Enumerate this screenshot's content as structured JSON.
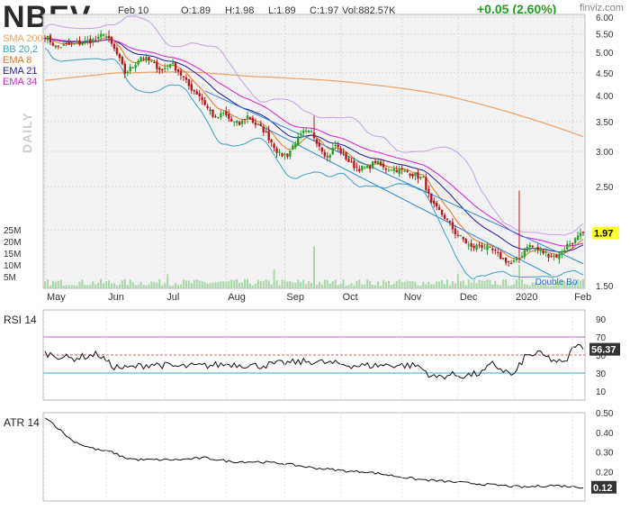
{
  "header": {
    "ticker": "NBEV",
    "date": "Feb 10",
    "open": "O:1.89",
    "high": "H:1.98",
    "low": "L:1.89",
    "close": "C:1.97",
    "volume": "Vol:882.57K",
    "change": "+0.05 (2.60%)",
    "logo": "finviz.com",
    "side_label": "DAILY"
  },
  "legend": [
    {
      "label": "SMA 200",
      "color": "#f0a060"
    },
    {
      "label": "BB 20,2",
      "color": "#3aa0c8"
    },
    {
      "label": "EMA 8",
      "color": "#e8761e"
    },
    {
      "label": "EMA 21",
      "color": "#1a1aa0"
    },
    {
      "label": "EMA 34",
      "color": "#d81ed8"
    }
  ],
  "colors": {
    "up": "#2aa02a",
    "down": "#b01e1e",
    "volume": "#a8d8a8",
    "price_tag_bg": "#ffff33",
    "channel": "#2a8ad8",
    "grid": "#d8d8d8"
  },
  "chart_data": [
    {
      "type": "line",
      "panel": "price",
      "scale": "log",
      "ylim": [
        1.5,
        6.0
      ],
      "y_ticks": [
        "6.00",
        "5.50",
        "5.00",
        "4.50",
        "4.00",
        "3.50",
        "3.00",
        "2.50",
        "2.00",
        "1.50"
      ],
      "y_tick_values": [
        6.0,
        5.5,
        5.0,
        4.5,
        4.0,
        3.5,
        3.0,
        2.5,
        2.0,
        1.5
      ],
      "months": [
        "May",
        "Jun",
        "Jul",
        "Aug",
        "Sep",
        "Oct",
        "Nov",
        "Dec",
        "2020",
        "Feb"
      ],
      "month_positions": [
        0,
        23,
        45,
        68,
        90,
        111,
        134,
        155,
        176,
        198
      ],
      "n_days": 203,
      "last_price": "1.97",
      "close_knots": [
        [
          0,
          5.45
        ],
        [
          4,
          5.15
        ],
        [
          10,
          5.2
        ],
        [
          16,
          5.3
        ],
        [
          20,
          5.35
        ],
        [
          22,
          5.55
        ],
        [
          25,
          5.2
        ],
        [
          27,
          4.95
        ],
        [
          30,
          4.5
        ],
        [
          33,
          4.65
        ],
        [
          36,
          4.9
        ],
        [
          40,
          4.75
        ],
        [
          44,
          4.55
        ],
        [
          47,
          4.75
        ],
        [
          50,
          4.55
        ],
        [
          54,
          4.2
        ],
        [
          58,
          4.0
        ],
        [
          61,
          3.75
        ],
        [
          64,
          3.55
        ],
        [
          67,
          3.65
        ],
        [
          70,
          3.5
        ],
        [
          73,
          3.45
        ],
        [
          76,
          3.6
        ],
        [
          79,
          3.45
        ],
        [
          82,
          3.35
        ],
        [
          85,
          3.15
        ],
        [
          88,
          2.95
        ],
        [
          91,
          2.95
        ],
        [
          94,
          3.15
        ],
        [
          97,
          3.3
        ],
        [
          100,
          3.3
        ],
        [
          103,
          3.1
        ],
        [
          106,
          2.9
        ],
        [
          109,
          3.1
        ],
        [
          112,
          2.95
        ],
        [
          115,
          2.8
        ],
        [
          118,
          2.75
        ],
        [
          121,
          2.75
        ],
        [
          124,
          2.85
        ],
        [
          127,
          2.75
        ],
        [
          130,
          2.75
        ],
        [
          133,
          2.72
        ],
        [
          136,
          2.7
        ],
        [
          139,
          2.65
        ],
        [
          142,
          2.6
        ],
        [
          145,
          2.28
        ],
        [
          148,
          2.2
        ],
        [
          151,
          2.1
        ],
        [
          154,
          1.97
        ],
        [
          157,
          1.9
        ],
        [
          160,
          1.82
        ],
        [
          163,
          1.85
        ],
        [
          166,
          1.82
        ],
        [
          169,
          1.78
        ],
        [
          172,
          1.72
        ],
        [
          175,
          1.68
        ],
        [
          178,
          1.72
        ],
        [
          181,
          1.85
        ],
        [
          184,
          1.82
        ],
        [
          187,
          1.78
        ],
        [
          190,
          1.75
        ],
        [
          193,
          1.75
        ],
        [
          196,
          1.85
        ],
        [
          199,
          1.9
        ],
        [
          202,
          1.97
        ]
      ],
      "spikes": [
        [
          101,
          3.6
        ],
        [
          178,
          2.45
        ],
        [
          24,
          5.6
        ]
      ],
      "volume_ticks": [
        "25M",
        "20M",
        "15M",
        "10M",
        "5M"
      ],
      "volume_tick_values": [
        25,
        20,
        15,
        10,
        5
      ],
      "volume_spikes": [
        [
          46,
          6
        ],
        [
          86,
          8
        ],
        [
          101,
          18
        ],
        [
          155,
          6
        ],
        [
          178,
          10
        ]
      ],
      "annotation": "Double Bo"
    },
    {
      "type": "line",
      "panel": "rsi",
      "title": "RSI 14",
      "ylim": [
        0,
        100
      ],
      "y_ticks": [
        "90",
        "70",
        "50",
        "30",
        "10"
      ],
      "y_tick_values": [
        90,
        70,
        50,
        30,
        10
      ],
      "reference_lines": [
        70,
        50,
        30
      ],
      "last_value": "56.37",
      "knots": [
        [
          0,
          52
        ],
        [
          10,
          46
        ],
        [
          20,
          51
        ],
        [
          25,
          38
        ],
        [
          30,
          35
        ],
        [
          40,
          40
        ],
        [
          50,
          37
        ],
        [
          60,
          38
        ],
        [
          70,
          40
        ],
        [
          80,
          38
        ],
        [
          90,
          41
        ],
        [
          100,
          43
        ],
        [
          110,
          40
        ],
        [
          118,
          38
        ],
        [
          130,
          39
        ],
        [
          140,
          38
        ],
        [
          146,
          25
        ],
        [
          152,
          28
        ],
        [
          158,
          27
        ],
        [
          164,
          30
        ],
        [
          168,
          40
        ],
        [
          172,
          33
        ],
        [
          176,
          27
        ],
        [
          180,
          48
        ],
        [
          185,
          52
        ],
        [
          190,
          45
        ],
        [
          195,
          40
        ],
        [
          199,
          62
        ],
        [
          202,
          56.37
        ]
      ]
    },
    {
      "type": "line",
      "panel": "atr",
      "title": "ATR 14",
      "ylim": [
        0.05,
        0.5
      ],
      "y_ticks": [
        "0.50",
        "0.40",
        "0.30",
        "0.20"
      ],
      "y_tick_values": [
        0.5,
        0.4,
        0.3,
        0.2
      ],
      "last_value": "0.12",
      "knots": [
        [
          0,
          0.48
        ],
        [
          5,
          0.42
        ],
        [
          10,
          0.36
        ],
        [
          15,
          0.33
        ],
        [
          20,
          0.31
        ],
        [
          25,
          0.3
        ],
        [
          30,
          0.27
        ],
        [
          35,
          0.26
        ],
        [
          40,
          0.26
        ],
        [
          50,
          0.26
        ],
        [
          60,
          0.27
        ],
        [
          70,
          0.25
        ],
        [
          80,
          0.25
        ],
        [
          90,
          0.24
        ],
        [
          100,
          0.22
        ],
        [
          108,
          0.21
        ],
        [
          115,
          0.2
        ],
        [
          120,
          0.2
        ],
        [
          130,
          0.18
        ],
        [
          140,
          0.16
        ],
        [
          150,
          0.15
        ],
        [
          160,
          0.14
        ],
        [
          170,
          0.13
        ],
        [
          180,
          0.12
        ],
        [
          190,
          0.13
        ],
        [
          202,
          0.12
        ]
      ]
    }
  ]
}
